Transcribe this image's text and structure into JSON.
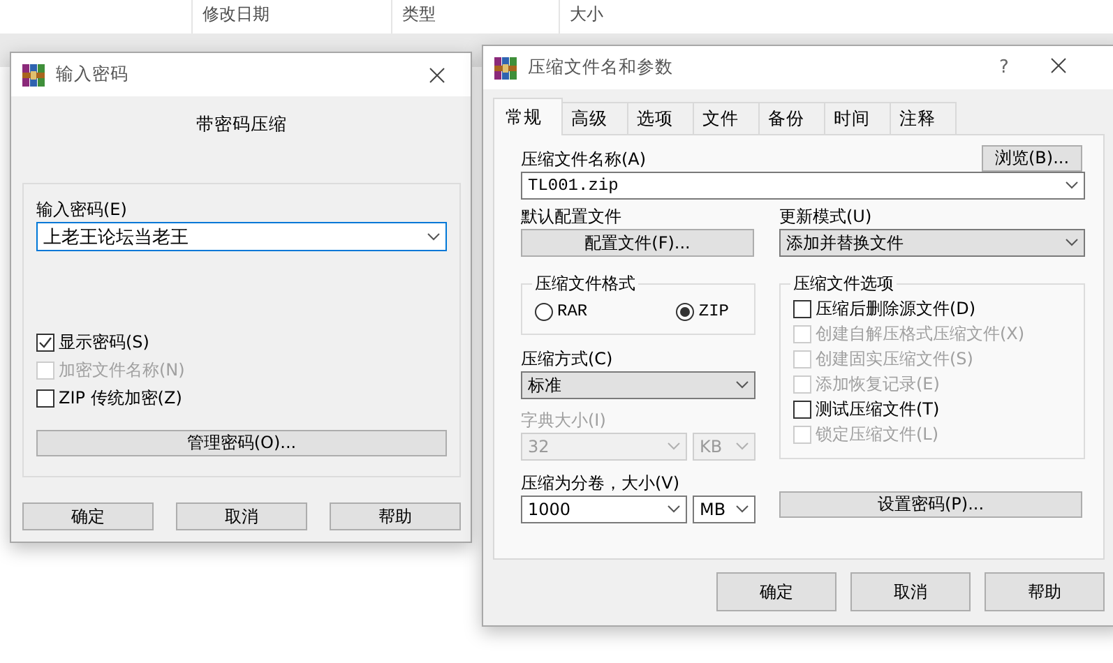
{
  "explorer": {
    "columns": [
      "修改日期",
      "类型",
      "大小"
    ]
  },
  "password_dialog": {
    "title": "输入密码",
    "heading": "带密码压缩",
    "password_label": "输入密码(E)",
    "password_value": "上老王论坛当老王",
    "checkboxes": [
      {
        "label": "显示密码(S)",
        "checked": true,
        "disabled": false
      },
      {
        "label": "加密文件名称(N)",
        "checked": false,
        "disabled": true
      },
      {
        "label": "ZIP 传统加密(Z)",
        "checked": false,
        "disabled": false
      }
    ],
    "manage_button": "管理密码(O)...",
    "buttons": [
      "确定",
      "取消",
      "帮助"
    ]
  },
  "archive_dialog": {
    "title": "压缩文件名和参数",
    "help_button": "?",
    "tabs": [
      {
        "label": "常规",
        "selected": true
      },
      {
        "label": "高级",
        "selected": false
      },
      {
        "label": "选项",
        "selected": false
      },
      {
        "label": "文件",
        "selected": false
      },
      {
        "label": "备份",
        "selected": false
      },
      {
        "label": "时间",
        "selected": false
      },
      {
        "label": "注释",
        "selected": false
      }
    ],
    "archive_name_label": "压缩文件名称(A)",
    "browse_button": "浏览(B)...",
    "archive_name": "TL001.zip",
    "profile_label": "默认配置文件",
    "profile_button": "配置文件(F)...",
    "update_mode_label": "更新模式(U)",
    "update_mode": "添加并替换文件",
    "format": {
      "label": "压缩文件格式",
      "options": [
        {
          "label": "RAR",
          "selected": false
        },
        {
          "label": "ZIP",
          "selected": true
        }
      ]
    },
    "method_label": "压缩方式(C)",
    "method": "标准",
    "dictionary": {
      "label": "字典大小(I)",
      "value": "32",
      "unit": "KB",
      "disabled": true
    },
    "volume": {
      "label": "压缩为分卷，大小(V)",
      "value": "1000",
      "unit": "MB",
      "disabled": false
    },
    "options": {
      "label": "压缩文件选项",
      "checkboxes": [
        {
          "label": "压缩后删除源文件(D)",
          "checked": false,
          "disabled": false
        },
        {
          "label": "创建自解压格式压缩文件(X)",
          "checked": false,
          "disabled": true
        },
        {
          "label": "创建固实压缩文件(S)",
          "checked": false,
          "disabled": true
        },
        {
          "label": "添加恢复记录(E)",
          "checked": false,
          "disabled": true
        },
        {
          "label": "测试压缩文件(T)",
          "checked": false,
          "disabled": false
        },
        {
          "label": "锁定压缩文件(L)",
          "checked": false,
          "disabled": true
        }
      ]
    },
    "set_password_button": "设置密码(P)...",
    "buttons": [
      "确定",
      "取消",
      "帮助"
    ]
  }
}
